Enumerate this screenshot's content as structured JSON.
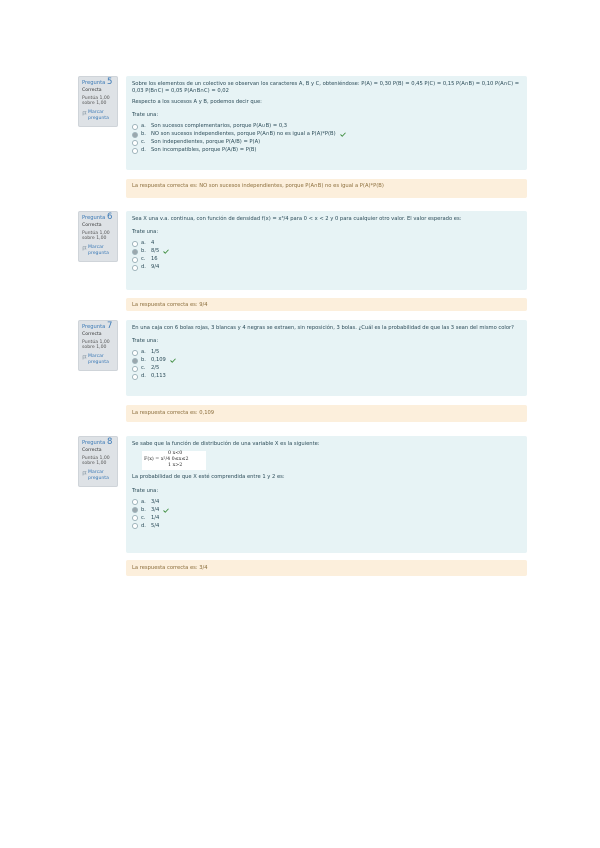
{
  "questions": [
    {
      "number_prefix": "Pregunta",
      "number": "5",
      "state": "Correcta",
      "grade": "Puntúa 1,00 sobre 1,00",
      "flag_label": "Marcar pregunta",
      "text": "Sobre los elementos de un colectivo se observan los caracteres A, B y C, obteniéndose: P(A) = 0,30 P(B) = 0,45 P(C) = 0,15 P(A∩B) = 0,10 P(A∩C) = 0,03 P(B∩C) = 0,05 P(A∩B∩C) = 0,02",
      "subtext": "Respecto a los sucesos A y B, podemos decir que:",
      "prompt": "Trate una:",
      "answers": [
        {
          "letter": "a.",
          "text": "Son sucesos complementarios, porque P(A∪B) = 0,3",
          "selected": false,
          "correct": false
        },
        {
          "letter": "b.",
          "text": "NO son sucesos independientes, porque P(A∩B) no es igual a P(A)*P(B)",
          "selected": true,
          "correct": true
        },
        {
          "letter": "c.",
          "text": "Son independientes, porque P(A/B) = P(A)",
          "selected": false,
          "correct": false
        },
        {
          "letter": "d.",
          "text": "Son incompatibles, porque P(A/B) = P(B)",
          "selected": false,
          "correct": false
        }
      ],
      "feedback": "La respuesta correcta es: NO son sucesos independientes, porque P(A∩B) no es igual a P(A)*P(B)"
    },
    {
      "number_prefix": "Pregunta",
      "number": "6",
      "state": "Correcta",
      "grade": "Puntúa 1,00 sobre 1,00",
      "flag_label": "Marcar pregunta",
      "text": "Sea X una v.a. continua, con función de densidad f(x) = x³/4 para 0 < x < 2 y 0 para cualquier otro valor. El valor esperado es:",
      "subtext": "",
      "prompt": "Trate una:",
      "answers": [
        {
          "letter": "a.",
          "text": "4",
          "selected": false,
          "correct": false
        },
        {
          "letter": "b.",
          "text": "8/5",
          "selected": true,
          "correct": true
        },
        {
          "letter": "c.",
          "text": "16",
          "selected": false,
          "correct": false
        },
        {
          "letter": "d.",
          "text": "9/4",
          "selected": false,
          "correct": false
        }
      ],
      "feedback": "La respuesta correcta es: 9/4"
    },
    {
      "number_prefix": "Pregunta",
      "number": "7",
      "state": "Correcta",
      "grade": "Puntúa 1,00 sobre 1,00",
      "flag_label": "Marcar pregunta",
      "text": "En una caja con 6 bolas rojas, 3 blancas y 4 negras se extraen, sin reposición, 3 bolas. ¿Cuál es la probabilidad de que las 3 sean del mismo color?",
      "subtext": "",
      "prompt": "Trate una:",
      "answers": [
        {
          "letter": "a.",
          "text": "1/5",
          "selected": false,
          "correct": false
        },
        {
          "letter": "b.",
          "text": "0,109",
          "selected": true,
          "correct": true
        },
        {
          "letter": "c.",
          "text": "2/5",
          "selected": false,
          "correct": false
        },
        {
          "letter": "d.",
          "text": "0,113",
          "selected": false,
          "correct": false
        }
      ],
      "feedback": "La respuesta correcta es: 0,109"
    },
    {
      "number_prefix": "Pregunta",
      "number": "8",
      "state": "Correcta",
      "grade": "Puntúa 1,00 sobre 1,00",
      "flag_label": "Marcar pregunta",
      "text": "Se sabe que la función de distribución de una variable X es la siguiente:",
      "formula": {
        "line1": "0    x<0",
        "line2": "F(x) = x²/4   0≤x≤2",
        "line3": "1    x>2"
      },
      "subtext": "La probabilidad de que X esté comprendida entre 1 y 2 es:",
      "prompt": "Trate una:",
      "answers": [
        {
          "letter": "a.",
          "text": "3/4",
          "selected": false,
          "correct": false
        },
        {
          "letter": "b.",
          "text": "3/4",
          "selected": true,
          "correct": true
        },
        {
          "letter": "c.",
          "text": "1/4",
          "selected": false,
          "correct": false
        },
        {
          "letter": "d.",
          "text": "5/4",
          "selected": false,
          "correct": false
        }
      ],
      "feedback": "La respuesta correcta es: 3/4"
    }
  ]
}
